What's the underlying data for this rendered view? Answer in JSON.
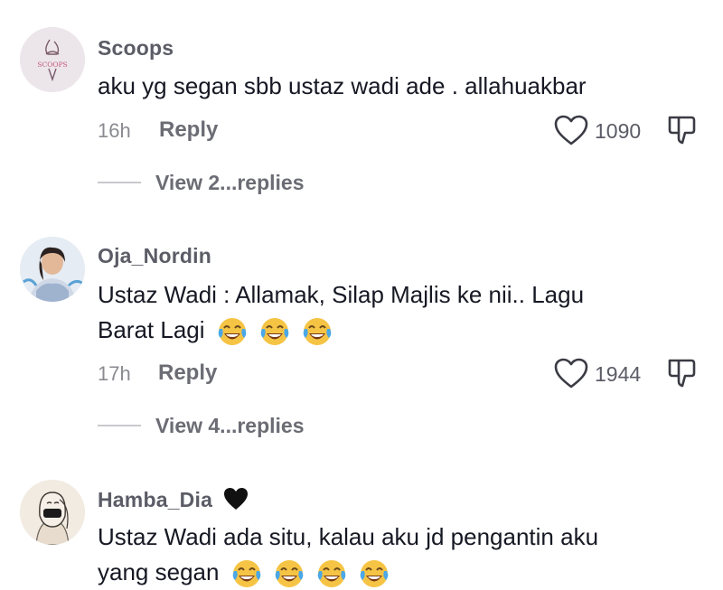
{
  "comments": [
    {
      "username": "Scoops",
      "avatar_text": "SCOOPS",
      "lines": [
        "aku yg segan sbb ustaz wadi ade . allahuakbar"
      ],
      "time": "16h",
      "reply_label": "Reply",
      "likes": "1090",
      "view_replies": "View 2...replies"
    },
    {
      "username": "Oja_Nordin",
      "lines": [
        "Ustaz Wadi : Allamak, Silap Majlis ke nii.. Lagu",
        "Barat Lagi"
      ],
      "emoji_count": 3,
      "time": "17h",
      "reply_label": "Reply",
      "likes": "1944",
      "view_replies": "View 4...replies"
    },
    {
      "username": "Hamba_Dia",
      "username_badge": "black-heart",
      "lines": [
        "Ustaz Wadi ada situ, kalau aku jd pengantin aku",
        "yang segan"
      ],
      "emoji_count": 4
    }
  ],
  "colors": {
    "text": "#161823",
    "muted": "#8a8b91",
    "username": "#5b5c66"
  },
  "icons": [
    "heart-outline-icon",
    "thumb-down-icon",
    "laughing-tears-emoji",
    "black-heart-icon"
  ]
}
